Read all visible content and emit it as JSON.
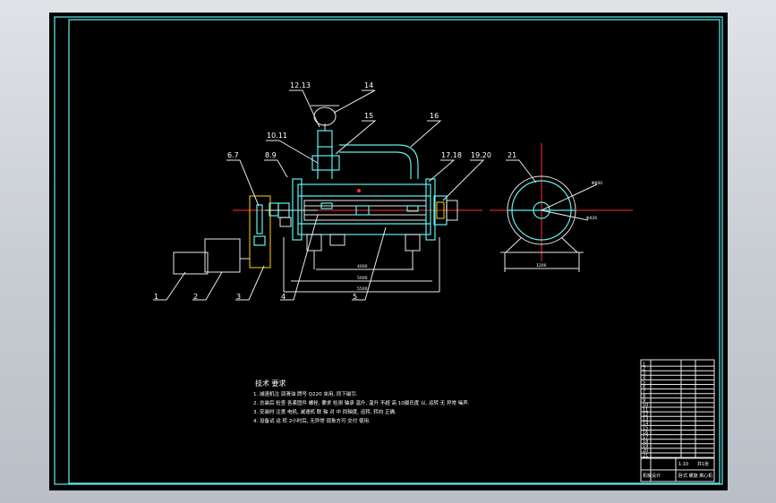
{
  "callouts": [
    "1",
    "2",
    "3",
    "4",
    "5",
    "6.7",
    "8.9",
    "10.11",
    "12.13",
    "14",
    "15",
    "16",
    "17.18",
    "19.20",
    "21"
  ],
  "dimensions": {
    "d1": "4000",
    "d2": "5000",
    "d3": "5500",
    "side_width": "1200",
    "side_r1": "Φ600",
    "side_r2": "Φ426"
  },
  "notes": {
    "title": "技术 要求",
    "lines": [
      "1. 减速机注 润滑油  牌号 Q220  夹用, 同下磁引.",
      "2. 总装后 检查 各紧固件 螺栓, 要求 检测 轴承 温升, 温升 不超 高 10摄氏度 以, 运转 无 异常 噪声.",
      "3. 安装时 注意 电机,  减速机 联 轴 对 中 同轴度, 运转, 转向 正确.",
      "4. 设备试 运 转 2小时后, 无异常 现象方可 交付 使用."
    ]
  },
  "title_block": {
    "rows": [
      "1",
      "2",
      "3",
      "4",
      "5",
      "6",
      "7",
      "8",
      "9",
      "10",
      "11",
      "12",
      "13",
      "14",
      "15",
      "16",
      "17",
      "18",
      "19",
      "20",
      "21"
    ],
    "scale": "1:10",
    "sheet": "共1张",
    "drawing_name": "卧式 螺旋 离心机",
    "company": "机械设计"
  },
  "colors": {
    "frame": "#5ff0f0",
    "centerline": "#ff3030",
    "hatch": "#ffd400",
    "text": "#ffffff"
  }
}
